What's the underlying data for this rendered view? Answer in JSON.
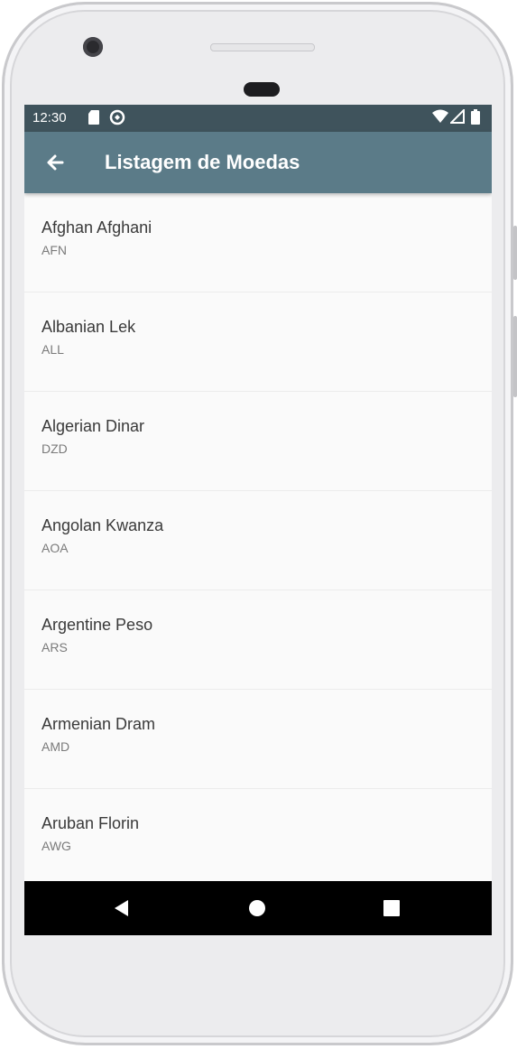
{
  "status_bar": {
    "time": "12:30",
    "icons_left": [
      "sd-card-icon",
      "sync-icon"
    ],
    "icons_right": [
      "wifi-icon",
      "cell-signal-icon",
      "battery-icon"
    ]
  },
  "app_bar": {
    "title": "Listagem de Moedas",
    "back_icon": "arrow-back-icon",
    "color": "#5b7b88"
  },
  "currencies": [
    {
      "name": "Afghan Afghani",
      "code": "AFN"
    },
    {
      "name": "Albanian Lek",
      "code": "ALL"
    },
    {
      "name": "Algerian Dinar",
      "code": "DZD"
    },
    {
      "name": "Angolan Kwanza",
      "code": "AOA"
    },
    {
      "name": "Argentine Peso",
      "code": "ARS"
    },
    {
      "name": "Armenian Dram",
      "code": "AMD"
    },
    {
      "name": "Aruban Florin",
      "code": "AWG"
    }
  ],
  "nav_bar": {
    "buttons": [
      "back-triangle-icon",
      "home-circle-icon",
      "recents-square-icon"
    ]
  }
}
